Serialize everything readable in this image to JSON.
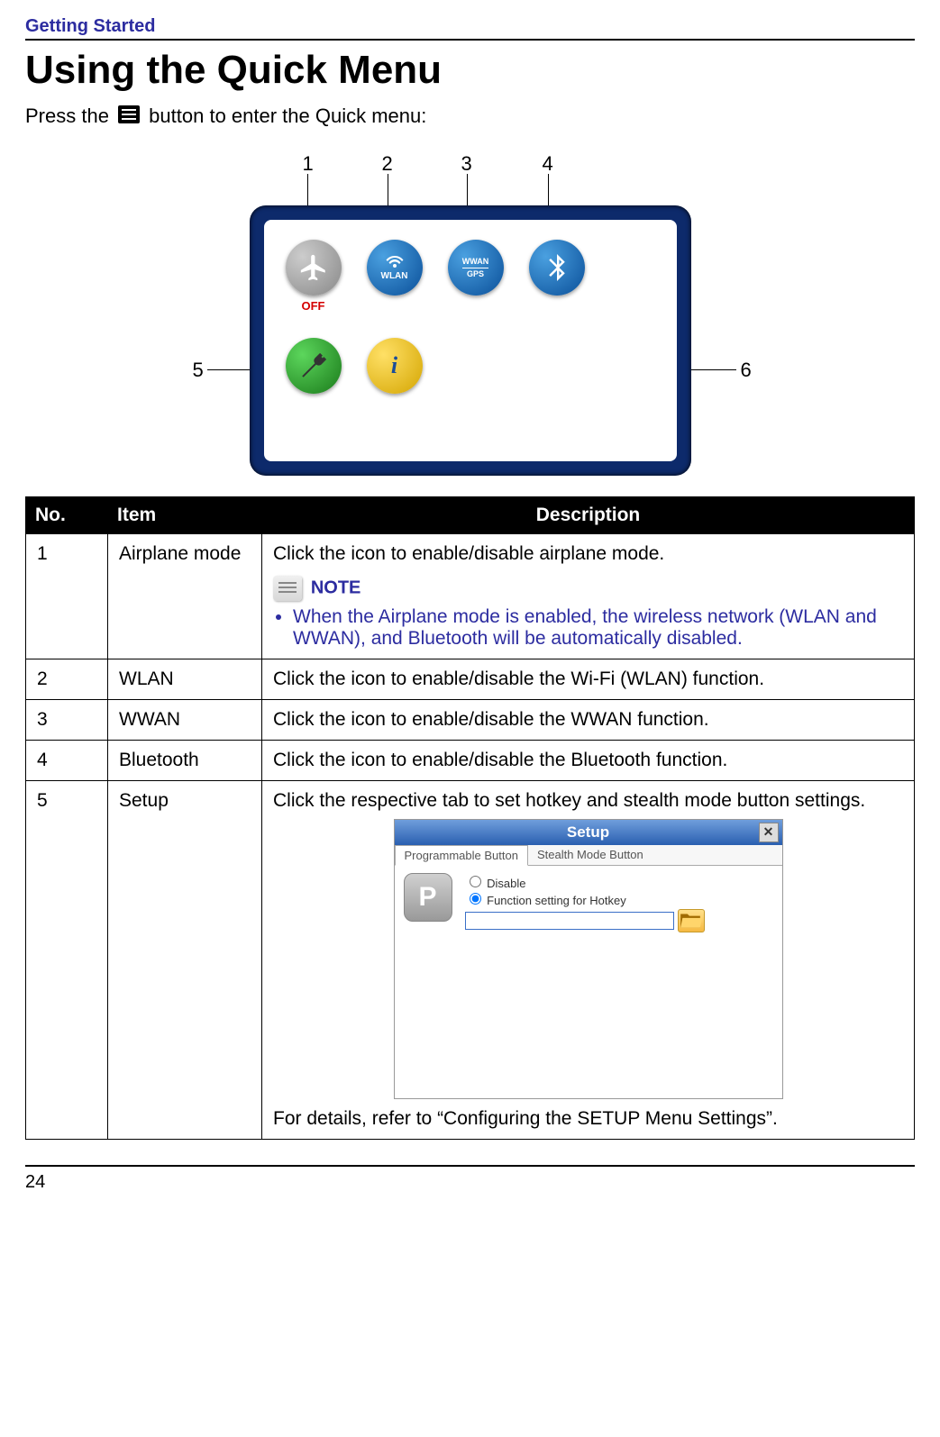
{
  "header": {
    "section": "Getting Started"
  },
  "title": "Using the Quick Menu",
  "intro": {
    "before": "Press the ",
    "after": " button to enter the Quick menu:"
  },
  "figure": {
    "callouts": {
      "c1": "1",
      "c2": "2",
      "c3": "3",
      "c4": "4",
      "c5": "5",
      "c6": "6"
    },
    "icons": {
      "airplane_off": "OFF",
      "wlan": "WLAN",
      "wwan_top": "WWAN",
      "wwan_bot": "GPS",
      "bt": "➝",
      "setup": "⚙",
      "info": "i"
    }
  },
  "table": {
    "head": {
      "no": "No.",
      "item": "Item",
      "desc": "Description"
    },
    "rows": [
      {
        "no": "1",
        "item": "Airplane mode",
        "desc_main": "Click the icon to enable/disable airplane mode.",
        "note_label": "NOTE",
        "note_text": "When the Airplane mode is enabled, the wireless network (WLAN and WWAN), and Bluetooth will be automatically disabled."
      },
      {
        "no": "2",
        "item": "WLAN",
        "desc_main": "Click the icon to enable/disable the Wi-Fi (WLAN) function."
      },
      {
        "no": "3",
        "item": "WWAN",
        "desc_main": "Click the icon to enable/disable the WWAN function."
      },
      {
        "no": "4",
        "item": "Bluetooth",
        "desc_main": "Click the icon to enable/disable the Bluetooth function."
      },
      {
        "no": "5",
        "item": "Setup",
        "desc_main": "Click the respective tab to set hotkey and stealth mode button settings.",
        "desc_footer": "For details, refer to “Configuring the SETUP Menu Settings”."
      }
    ]
  },
  "setup_dialog": {
    "title": "Setup",
    "tab1": "Programmable Button",
    "tab2": "Stealth Mode Button",
    "p_label": "P",
    "radio_disable": "Disable",
    "radio_function": "Function setting for Hotkey"
  },
  "footer": {
    "page": "24"
  }
}
